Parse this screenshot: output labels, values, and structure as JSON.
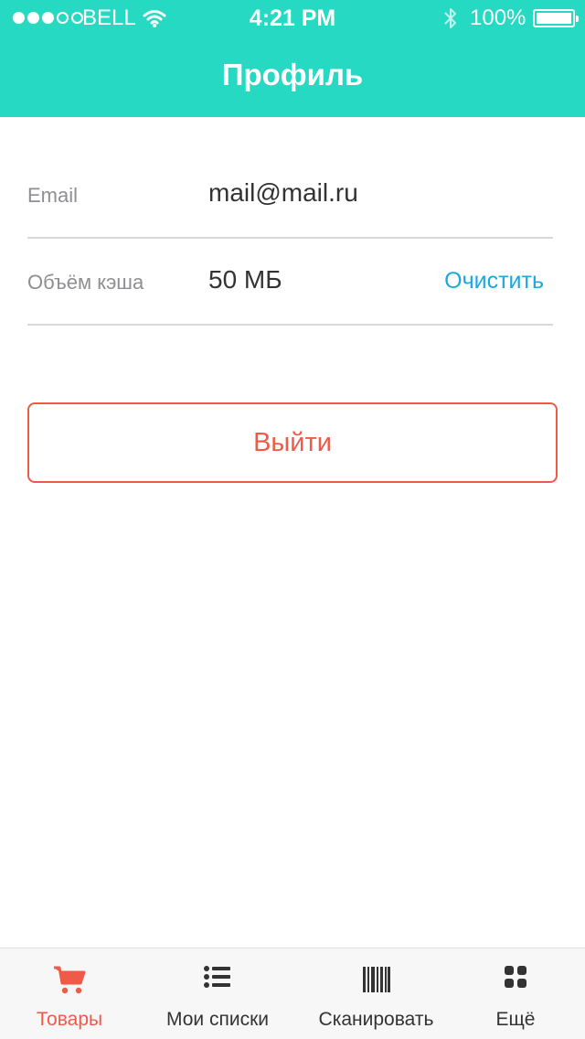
{
  "status_bar": {
    "carrier": "BELL",
    "time": "4:21 PM",
    "battery": "100%"
  },
  "nav": {
    "title": "Профиль"
  },
  "profile": {
    "email_label": "Email",
    "email_value": "mail@mail.ru",
    "cache_label": "Объём кэша",
    "cache_value": "50 МБ",
    "clear_label": "Очистить"
  },
  "logout_label": "Выйти",
  "tabs": [
    {
      "label": "Товары",
      "icon": "cart-icon",
      "active": true
    },
    {
      "label": "Мои списки",
      "icon": "list-icon",
      "active": false
    },
    {
      "label": "Сканировать",
      "icon": "barcode-icon",
      "active": false
    },
    {
      "label": "Ещё",
      "icon": "grid-icon",
      "active": false
    }
  ],
  "colors": {
    "header": "#26d9c3",
    "accent": "#f05a48",
    "link": "#1aa8e0"
  }
}
